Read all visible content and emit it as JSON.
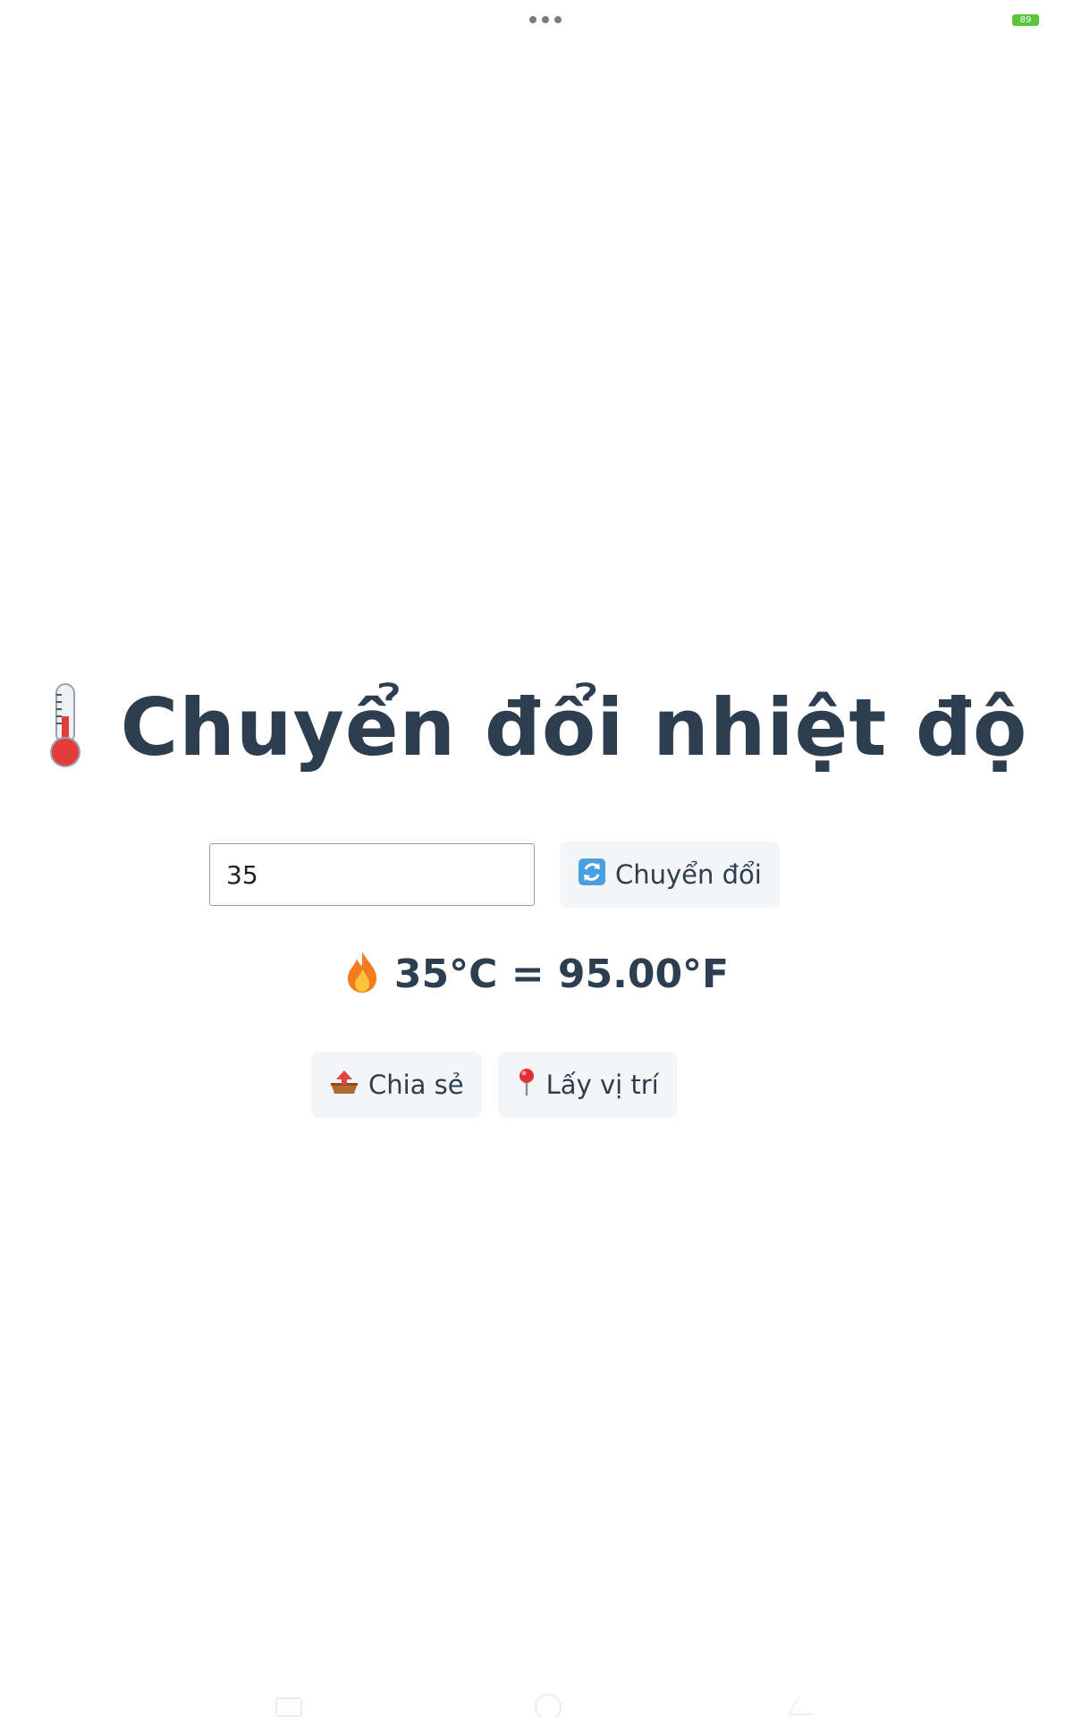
{
  "status_bar": {
    "battery_level": "89",
    "battery_color": "#5ac53a"
  },
  "title": {
    "icon": "thermometer-icon",
    "text": "Chuyển đổi nhiệt độ"
  },
  "converter": {
    "input_value": "35",
    "convert_icon": "refresh-arrows-icon",
    "convert_label": "Chuyển đổi"
  },
  "result": {
    "icon": "fire-icon",
    "text": "35°C = 95.00°F"
  },
  "actions": {
    "share_icon": "outbox-tray-icon",
    "share_label": "Chia sẻ",
    "location_icon": "map-pin-icon",
    "location_label": "Lấy vị trí"
  },
  "colors": {
    "title_text": "#2c3e50",
    "button_bg": "#f4f5f6"
  }
}
